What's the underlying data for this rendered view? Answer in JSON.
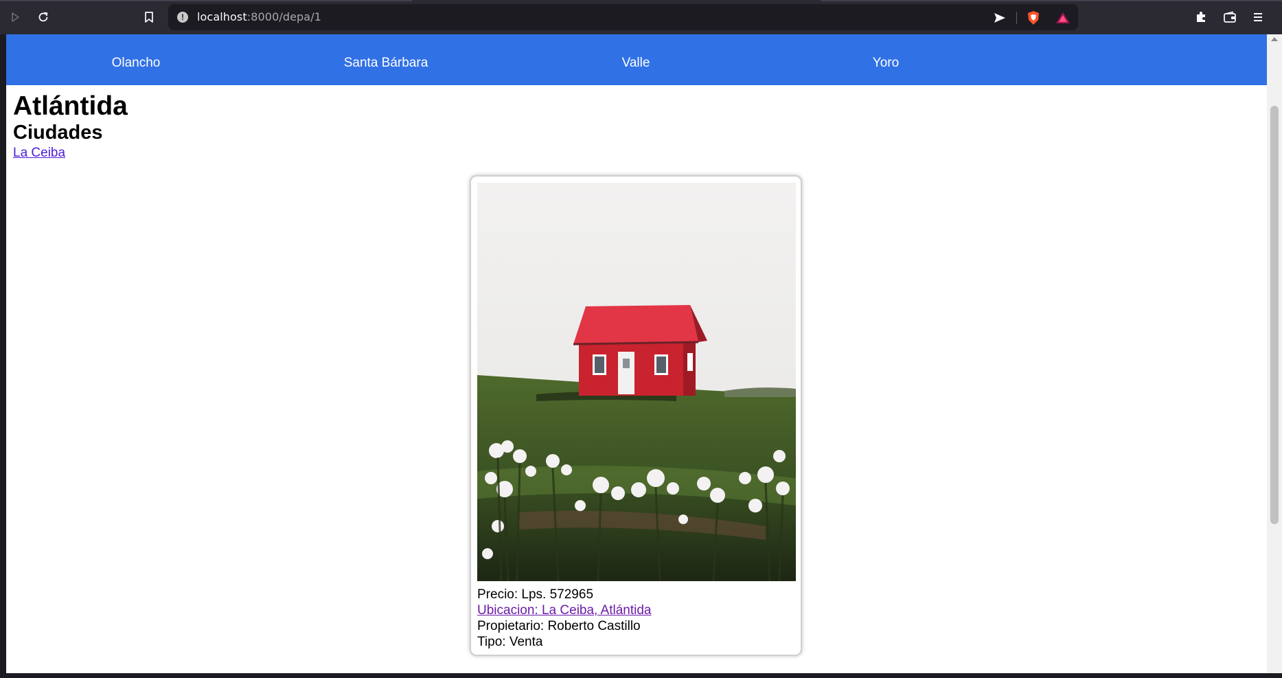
{
  "browser": {
    "url_host": "localhost",
    "url_path": ":8000/depa/1",
    "icons": [
      "play-icon",
      "reload-icon",
      "bookmark-icon",
      "info-icon",
      "send-icon",
      "brave-shield-icon",
      "brave-rewards-icon",
      "extensions-icon",
      "wallet-icon",
      "menu-icon"
    ]
  },
  "nav": {
    "items": [
      "Olancho",
      "Santa Bárbara",
      "Valle",
      "Yoro"
    ],
    "cut_off_items": [
      "",
      "",
      "",
      "",
      ""
    ]
  },
  "page": {
    "department": "Atlántida",
    "cities_heading": "Ciudades",
    "cities": [
      "La Ceiba"
    ]
  },
  "listing": {
    "precio": "Precio: Lps. 572965",
    "ubicacion": "Ubicacion: La Ceiba, Atlántida",
    "propietario": "Propietario: Roberto Castillo",
    "tipo": "Tipo: Venta"
  },
  "colors": {
    "nav_bg": "#3171e6",
    "toolbar_bg": "#2b2a33",
    "link_visited": "#6a1aa8",
    "house_red": "#c8232e"
  }
}
